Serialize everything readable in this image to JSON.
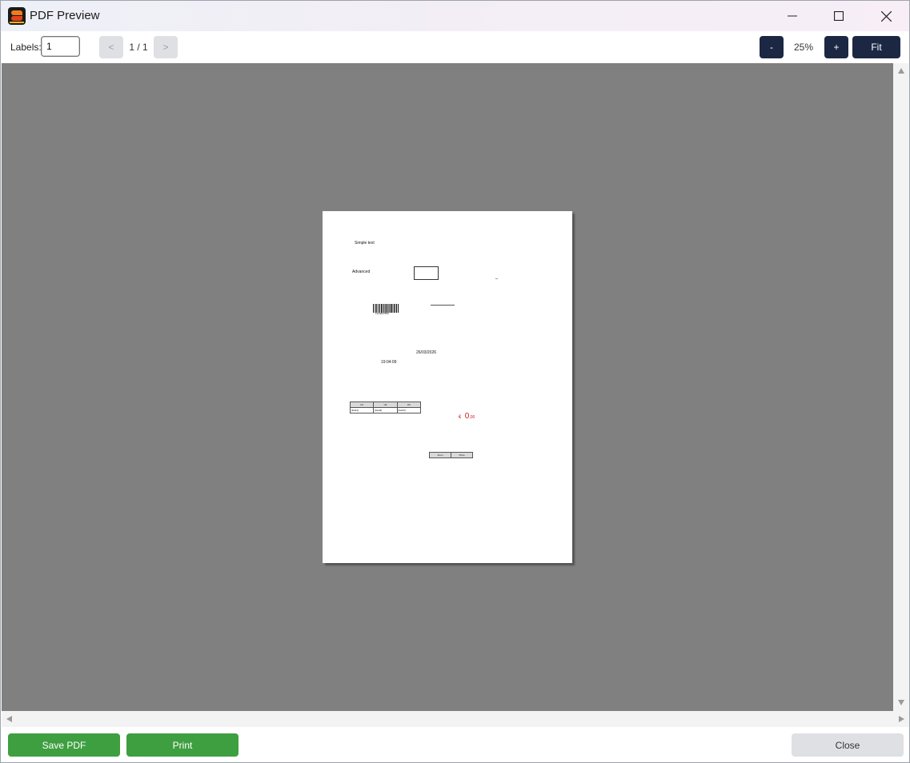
{
  "window": {
    "title": "PDF Preview",
    "icons": [
      "app-logo-icon",
      "minimize-icon",
      "maximize-icon",
      "close-icon"
    ]
  },
  "toolbar": {
    "labels_label": "Labels:",
    "labels_value": "1",
    "prev_label": "<",
    "page_indicator": "1 / 1",
    "next_label": ">",
    "zoom_out_label": "-",
    "zoom_level": "25%",
    "zoom_in_label": "+",
    "fit_label": "Fit"
  },
  "page": {
    "simple_text": "Simple text",
    "advanced_text": "Advanced",
    "barcode_number": "1234567890",
    "date": "26/03/2026",
    "time": "19:04:09",
    "table1": {
      "headers": [
        "H1",
        "H2",
        "H3"
      ],
      "cells": [
        "[field1]",
        "[field2]",
        "[field3]"
      ]
    },
    "currency": {
      "symbol": "€",
      "integer": "0",
      "decimal": ",00"
    },
    "table2": {
      "headers": [
        "From",
        "Price"
      ]
    }
  },
  "footer": {
    "save_pdf_label": "Save PDF",
    "print_label": "Print",
    "close_label": "Close"
  },
  "colors": {
    "nav_dark": "#1c2843",
    "green": "#3e9f41",
    "preview_bg": "#808080",
    "currency_red": "#d02020"
  }
}
